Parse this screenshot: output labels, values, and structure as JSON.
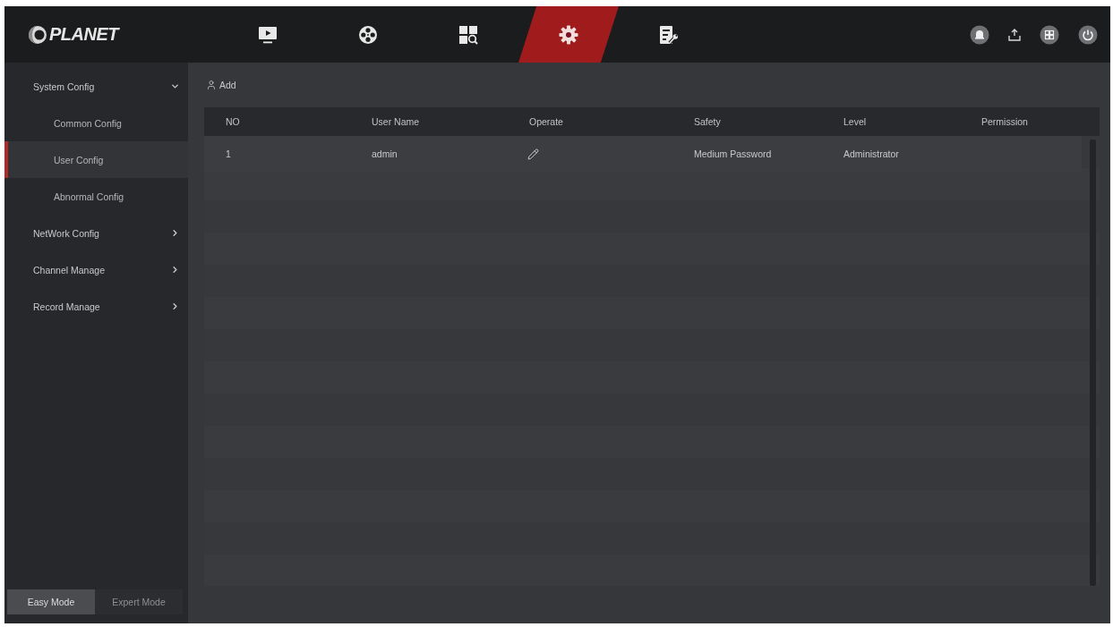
{
  "header": {
    "logo": "PLANET",
    "nav_tabs": [
      {
        "kind": "live",
        "selected": false
      },
      {
        "kind": "playback",
        "selected": false
      },
      {
        "kind": "search",
        "selected": false
      },
      {
        "kind": "settings",
        "selected": true
      },
      {
        "kind": "maintenance",
        "selected": false
      }
    ],
    "actions": [
      {
        "kind": "alarm"
      },
      {
        "kind": "download"
      },
      {
        "kind": "grid"
      },
      {
        "kind": "power"
      }
    ]
  },
  "sidebar": {
    "menu": [
      {
        "label": "System Config",
        "expanded": true,
        "children": [
          {
            "label": "Common Config",
            "selected": false
          },
          {
            "label": "User Config",
            "selected": true
          },
          {
            "label": "Abnormal Config",
            "selected": false
          }
        ]
      },
      {
        "label": "NetWork Config",
        "expanded": false
      },
      {
        "label": "Channel Manage",
        "expanded": false
      },
      {
        "label": "Record Manage",
        "expanded": false
      }
    ],
    "modes": [
      {
        "label": "Easy Mode",
        "selected": true
      },
      {
        "label": "Expert Mode",
        "selected": false
      }
    ]
  },
  "toolbar": {
    "add_button": "Add"
  },
  "table": {
    "columns": [
      "NO",
      "User Name",
      "Operate",
      "Safety",
      "Level",
      "Permission"
    ],
    "rows": [
      {
        "cells": [
          {
            "kind": "text",
            "text": "1"
          },
          {
            "kind": "text",
            "text": "admin"
          },
          {
            "kind": "edit"
          },
          {
            "kind": "text",
            "text": "Medium Password"
          },
          {
            "kind": "text",
            "text": "Administrator"
          }
        ]
      }
    ]
  }
}
